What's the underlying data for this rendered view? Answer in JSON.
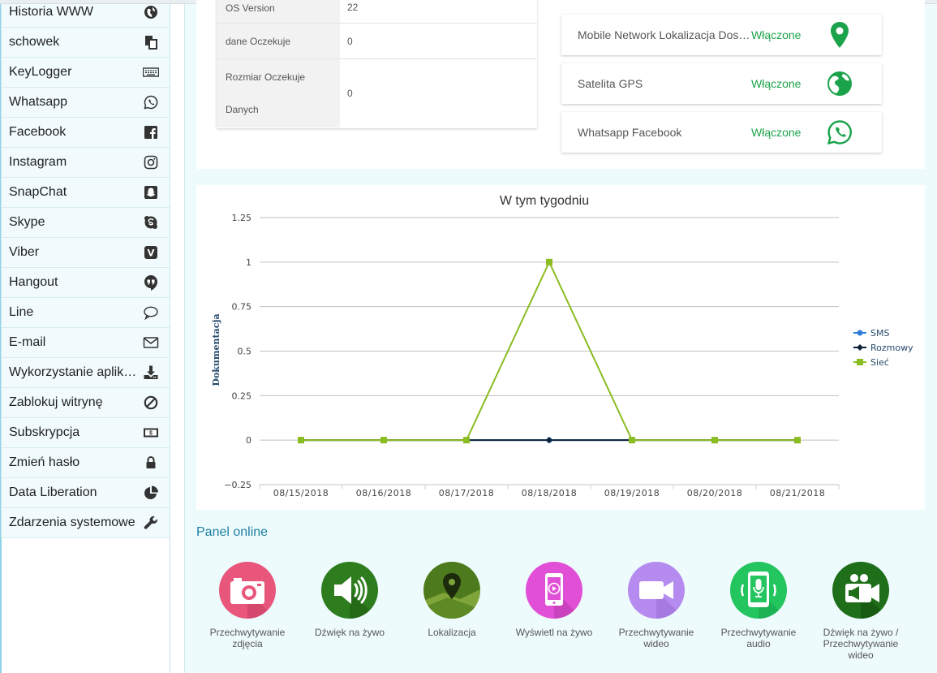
{
  "sidebar": {
    "items": [
      {
        "label": "Historia WWW",
        "icon": "globe-icon"
      },
      {
        "label": "schowek",
        "icon": "clipboard-icon"
      },
      {
        "label": "KeyLogger",
        "icon": "keyboard-icon"
      },
      {
        "label": "Whatsapp",
        "icon": "whatsapp-icon"
      },
      {
        "label": "Facebook",
        "icon": "facebook-icon"
      },
      {
        "label": "Instagram",
        "icon": "instagram-icon"
      },
      {
        "label": "SnapChat",
        "icon": "snapchat-icon"
      },
      {
        "label": "Skype",
        "icon": "skype-icon"
      },
      {
        "label": "Viber",
        "icon": "viber-icon"
      },
      {
        "label": "Hangout",
        "icon": "hangout-icon"
      },
      {
        "label": "Line",
        "icon": "chat-bubble-icon"
      },
      {
        "label": "E-mail",
        "icon": "envelope-icon"
      },
      {
        "label": "Wykorzystanie aplikacji",
        "icon": "download-icon"
      },
      {
        "label": "Zablokuj witrynę",
        "icon": "block-icon"
      },
      {
        "label": "Subskrypcja",
        "icon": "money-icon"
      },
      {
        "label": "Zmień hasło",
        "icon": "lock-icon"
      },
      {
        "label": "Data Liberation",
        "icon": "pie-chart-icon"
      },
      {
        "label": "Zdarzenia systemowe",
        "icon": "wrench-icon"
      }
    ]
  },
  "device_info": {
    "rows": [
      {
        "key": "OS Version",
        "value": "22"
      },
      {
        "key": "dane Oczekuje",
        "value": "0"
      },
      {
        "key": "Rozmiar Oczekuje Danych",
        "key_line1": "Rozmiar Oczekuje",
        "key_line2": "Danych",
        "value": "0"
      }
    ]
  },
  "status": [
    {
      "name": "Mobile Network Lokalizacja Dostępna",
      "state": "Włączone",
      "icon": "map-marker-icon"
    },
    {
      "name": "Satelita GPS",
      "state": "Włączone",
      "icon": "globe-icon"
    },
    {
      "name": "Whatsapp Facebook",
      "state": "Włączone",
      "icon": "whatsapp-icon"
    }
  ],
  "chart_data": {
    "type": "line",
    "title": "W tym tygodniu",
    "ylabel": "Dokumentacja",
    "xlabel": "",
    "categories": [
      "08/15/2018",
      "08/16/2018",
      "08/17/2018",
      "08/18/2018",
      "08/19/2018",
      "08/20/2018",
      "08/21/2018"
    ],
    "yticks": [
      "1.25",
      "1",
      "0.75",
      "0.5",
      "0.25",
      "0",
      "−0.25"
    ],
    "ylim": [
      -0.25,
      1.25
    ],
    "grid": true,
    "legend_position": "right",
    "series": [
      {
        "name": "SMS",
        "color": "#2f7ed8",
        "marker": "circle",
        "values": [
          0,
          0,
          0,
          0,
          0,
          0,
          0
        ]
      },
      {
        "name": "Rozmowy",
        "color": "#0d233a",
        "marker": "diamond",
        "values": [
          0,
          0,
          0,
          0,
          0,
          0,
          0
        ]
      },
      {
        "name": "Sieć",
        "color": "#8bbc21",
        "marker": "square",
        "values": [
          0,
          0,
          0,
          1,
          0,
          0,
          0
        ]
      }
    ]
  },
  "panel_online": {
    "title": "Panel online",
    "tiles": [
      {
        "label": "Przechwytywanie zdjęcia",
        "icon": "camera-icon",
        "color": "#e8567c"
      },
      {
        "label": "Dźwięk na żywo",
        "icon": "speaker-icon",
        "color": "#2d7d1e"
      },
      {
        "label": "Lokalizacja",
        "icon": "location-icon",
        "color": "#4d7a1c"
      },
      {
        "label": "Wyświetl na żywo",
        "icon": "phone-play-icon",
        "color": "#e04fd6"
      },
      {
        "label": "Przechwytywanie wideo",
        "icon": "video-camera-icon",
        "color": "#b68bef"
      },
      {
        "label": "Przechwytywanie audio",
        "icon": "microphone-icon",
        "color": "#22c55e"
      },
      {
        "label": "Dźwięk na żywo / Przechwytywanie wideo",
        "icon": "megaphone-video-icon",
        "color": "#1f6e1a"
      }
    ]
  }
}
